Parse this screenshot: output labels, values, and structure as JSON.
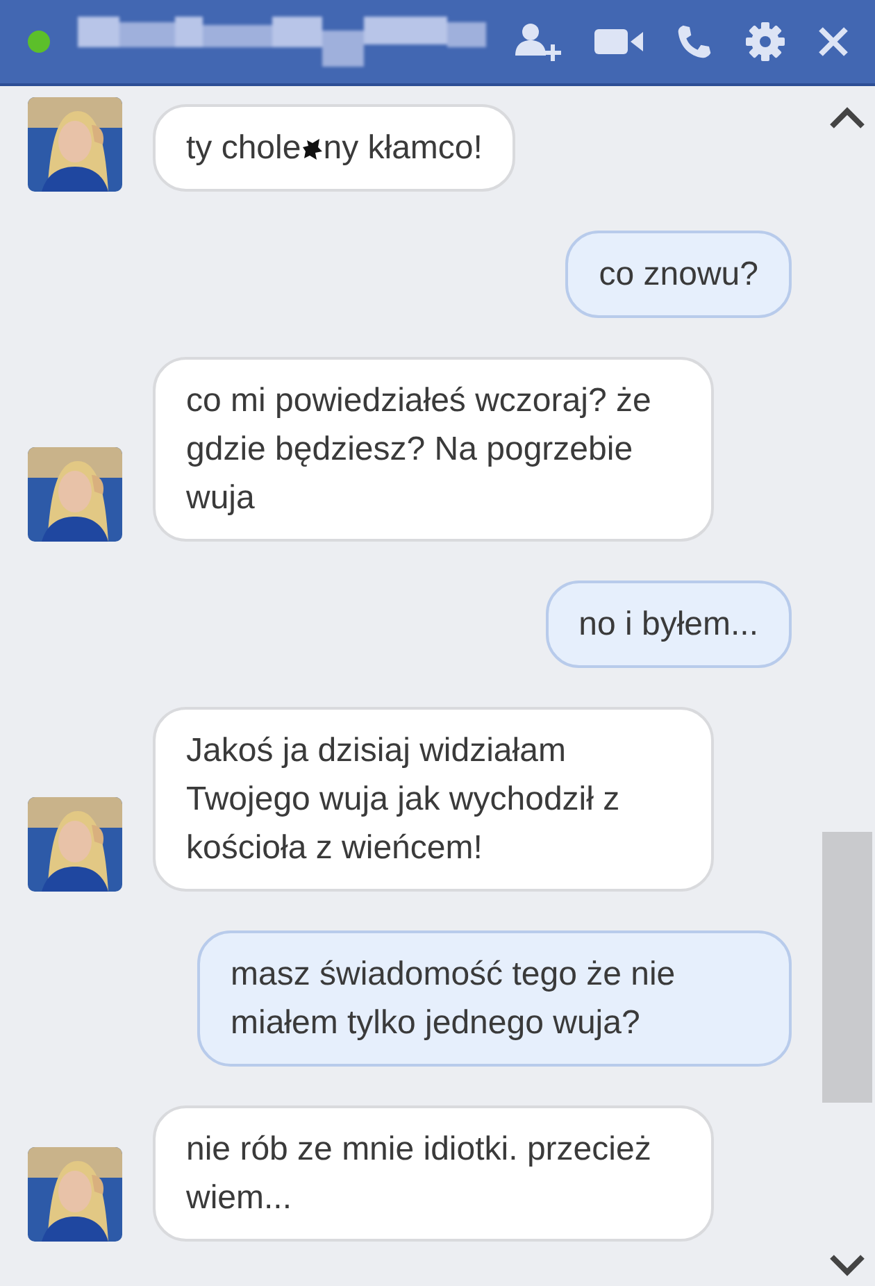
{
  "header": {
    "online": true
  },
  "messages": [
    {
      "kind": "them",
      "parts": [
        "ty chole",
        "ny kłamco!"
      ],
      "censored": true
    },
    {
      "kind": "me",
      "parts": [
        "co znowu?"
      ]
    },
    {
      "kind": "them",
      "parts": [
        "co mi powiedziałeś wczoraj? że gdzie będziesz? Na pogrzebie wuja"
      ]
    },
    {
      "kind": "me",
      "parts": [
        "no i byłem..."
      ]
    },
    {
      "kind": "them",
      "parts": [
        "Jakoś ja dzisiaj widziałam Twojego wuja jak wychodził z kościoła z wieńcem!"
      ]
    },
    {
      "kind": "me",
      "parts": [
        "masz świadomość tego że nie miałem tylko jednego wuja?"
      ]
    },
    {
      "kind": "them",
      "parts": [
        "nie rób ze mnie idiotki. przecież wiem..."
      ]
    }
  ]
}
